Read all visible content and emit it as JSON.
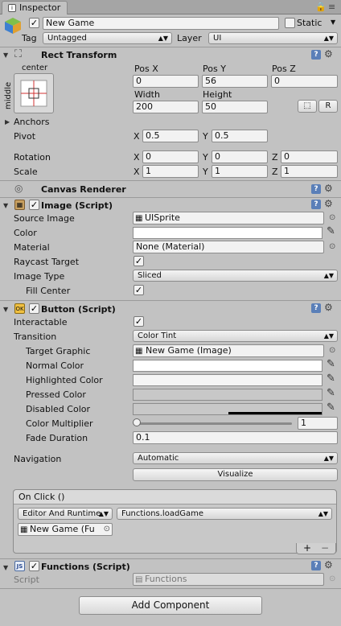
{
  "window": {
    "tab_title": "Inspector",
    "lock_glyph": "🔒",
    "menu_glyph": "≡"
  },
  "object": {
    "name": "New Game",
    "static_label": "Static",
    "tag_label": "Tag",
    "tag_value": "Untagged",
    "layer_label": "Layer",
    "layer_value": "UI"
  },
  "rect_transform": {
    "title": "Rect Transform",
    "anchor_h": "center",
    "anchor_v": "middle",
    "headers": {
      "pos_x": "Pos X",
      "pos_y": "Pos Y",
      "pos_z": "Pos Z",
      "width": "Width",
      "height": "Height"
    },
    "values": {
      "pos_x": "0",
      "pos_y": "56",
      "pos_z": "0",
      "width": "200",
      "height": "50"
    },
    "r_button": "R",
    "anchors_label": "Anchors",
    "pivot_label": "Pivot",
    "pivot": {
      "x": "0.5",
      "y": "0.5"
    },
    "rotation_label": "Rotation",
    "rotation": {
      "x": "0",
      "y": "0",
      "z": "0"
    },
    "scale_label": "Scale",
    "scale": {
      "x": "1",
      "y": "1",
      "z": "1"
    },
    "axis": {
      "x": "X",
      "y": "Y",
      "z": "Z"
    }
  },
  "canvas_renderer": {
    "title": "Canvas Renderer"
  },
  "image": {
    "title": "Image (Script)",
    "source_image_label": "Source Image",
    "source_image_value": "UISprite",
    "color_label": "Color",
    "material_label": "Material",
    "material_value": "None (Material)",
    "raycast_label": "Raycast Target",
    "image_type_label": "Image Type",
    "image_type_value": "Sliced",
    "fill_center_label": "Fill Center"
  },
  "button": {
    "title": "Button (Script)",
    "interactable_label": "Interactable",
    "transition_label": "Transition",
    "transition_value": "Color Tint",
    "target_graphic_label": "Target Graphic",
    "target_graphic_value": "New Game (Image)",
    "normal_color_label": "Normal Color",
    "highlighted_color_label": "Highlighted Color",
    "pressed_color_label": "Pressed Color",
    "disabled_color_label": "Disabled Color",
    "color_multiplier_label": "Color Multiplier",
    "color_multiplier_value": "1",
    "color_multiplier_fraction": 0.0,
    "fade_duration_label": "Fade Duration",
    "fade_duration_value": "0.1",
    "navigation_label": "Navigation",
    "navigation_value": "Automatic",
    "visualize_label": "Visualize",
    "onclick_title": "On Click ()",
    "runtime_value": "Editor And Runtime",
    "function_value": "Functions.loadGame",
    "object_value": "New Game (Fu",
    "plus": "+",
    "minus": "−"
  },
  "functions": {
    "title": "Functions (Script)",
    "script_label": "Script",
    "script_value": "Functions"
  },
  "add_component_label": "Add Component",
  "colors": {
    "background": "#c2c2c2",
    "normal_color": "#ffffff",
    "highlighted_color": "#f5f5f5",
    "pressed_color": "#c8c8c8",
    "disabled_color": "#c8c8c8",
    "help_blue": "#5a7fb8"
  }
}
